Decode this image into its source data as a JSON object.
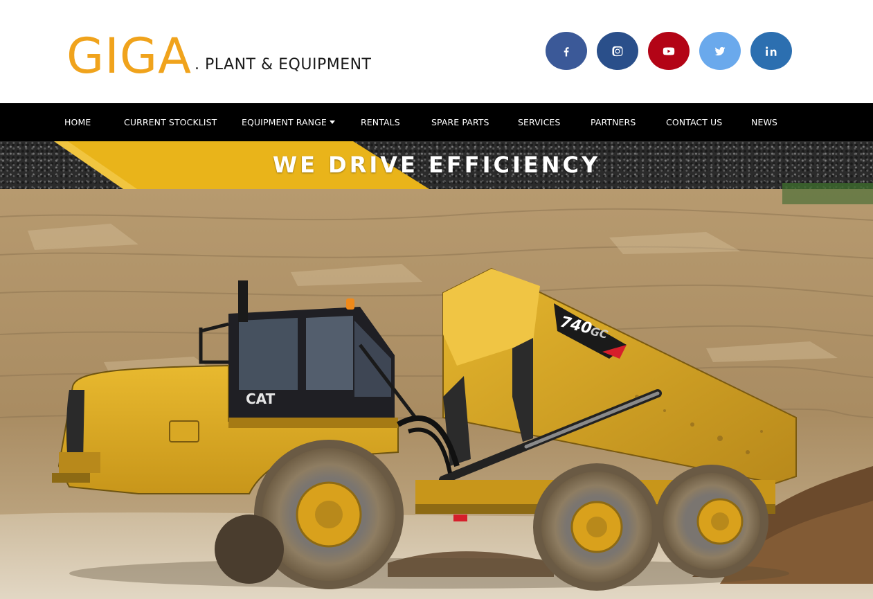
{
  "brand": {
    "name": "GIGA",
    "subtitle": ". PLANT & EQUIPMENT",
    "name_color": "#f0a31c"
  },
  "social": [
    {
      "icon": "facebook-icon",
      "color": "#3b5998"
    },
    {
      "icon": "instagram-icon",
      "color": "#2a4f8a"
    },
    {
      "icon": "youtube-icon",
      "color": "#b30416"
    },
    {
      "icon": "twitter-icon",
      "color": "#6aa9ec"
    },
    {
      "icon": "linkedin-icon",
      "color": "#2c6fb0"
    }
  ],
  "nav": {
    "items": [
      {
        "label": "HOME"
      },
      {
        "label": "CURRENT STOCKLIST"
      },
      {
        "label": "EQUIPMENT RANGE",
        "dropdown": true
      },
      {
        "label": "RENTALS"
      },
      {
        "label": "SPARE PARTS"
      },
      {
        "label": "SERVICES"
      },
      {
        "label": "PARTNERS"
      },
      {
        "label": "CONTACT US"
      },
      {
        "label": "NEWS"
      }
    ]
  },
  "banner": {
    "tagline": "WE DRIVE EFFICIENCY",
    "accent_color": "#e9b41a"
  },
  "hero": {
    "image_alt": "Yellow articulated dump truck in a quarry",
    "truck_model": "740",
    "truck_model_suffix": "GC",
    "truck_brand": "CAT"
  }
}
